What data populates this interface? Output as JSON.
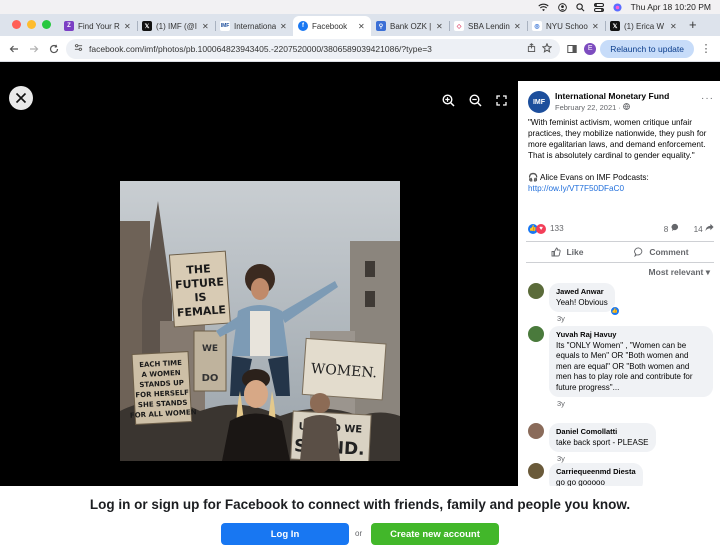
{
  "menubar": {
    "datetime": "Thu Apr 18  10:20 PM"
  },
  "tabs": [
    {
      "label": "Find Your R",
      "fav": "Z",
      "color": "#7b3fc4"
    },
    {
      "label": "(1) IMF (@I",
      "fav": "𝕏",
      "color": "#111111"
    },
    {
      "label": "Internationa",
      "fav": "IMF",
      "color": "#1c4e9c"
    },
    {
      "label": "Facebook",
      "fav": "f",
      "color": "#1877f2"
    },
    {
      "label": "Bank OZK |",
      "fav": "⚲",
      "color": "#3b6fd6"
    },
    {
      "label": "SBA Lendin",
      "fav": "◇",
      "color": "#d9345f"
    },
    {
      "label": "NYU Schoo",
      "fav": "◎",
      "color": "#2c6bd3"
    },
    {
      "label": "(1) Erica W",
      "fav": "𝕏",
      "color": "#111111"
    }
  ],
  "address": {
    "url": "facebook.com/imf/photos/pb.100064823943405.-2207520000/3806589039421086/?type=3",
    "profile_initial": "E",
    "relaunch": "Relaunch to update"
  },
  "post": {
    "page_name": "International Monetary Fund",
    "avatar_text": "IMF",
    "date": "February 22, 2021 · ",
    "text": "\"With feminist activism, women critique unfair practices, they mobilize nationwide, they push for more egalitarian laws, and demand enforcement. That is absolutely cardinal to gender equality.\"",
    "podcast": "🎧 Alice Evans on IMF Podcasts:",
    "link": "http://ow.ly/VT7F50DFaC0",
    "reaction_count": "133",
    "comment_count": "8",
    "share_count": "14",
    "like_label": "Like",
    "comment_label": "Comment",
    "sort_label": "Most relevant"
  },
  "comments": [
    {
      "name": "Jawed Anwar",
      "text": "Yeah! Obvious",
      "time": "3y",
      "avatar_color": "#5b6b3a"
    },
    {
      "name": "Yuvah Raj Havuy",
      "text": "Its \"ONLY Women\" , \"Women can be equals to Men\" OR \"Both women and men are equal\" OR \"Both women and men has to play role and contribute for future progress\"...",
      "time": "3y",
      "avatar_color": "#4a7a3c"
    },
    {
      "name": "Daniel Comollatti",
      "text": "take back sport - PLEASE",
      "time": "3y",
      "avatar_color": "#8a6b5a"
    },
    {
      "name": "Carriequeenmd Diesta",
      "text": "go go gooooo",
      "time": "",
      "avatar_color": "#6a5a3a"
    }
  ],
  "photo": {
    "sign1": "THE FUTURE IS FEMALE",
    "sign2": "EACH TIME A WOMEN STANDS UP FOR HERSELF SHE STANDS FOR ALL WOMEN",
    "sign3": "WOMEN.",
    "sign4": "UNITED WE STAND.",
    "sign5": "WE WOMEN NOT DO"
  },
  "banner": {
    "message": "Log in or sign up for Facebook to connect with friends, family and people you know.",
    "login": "Log In",
    "or": "or",
    "create": "Create new account"
  }
}
